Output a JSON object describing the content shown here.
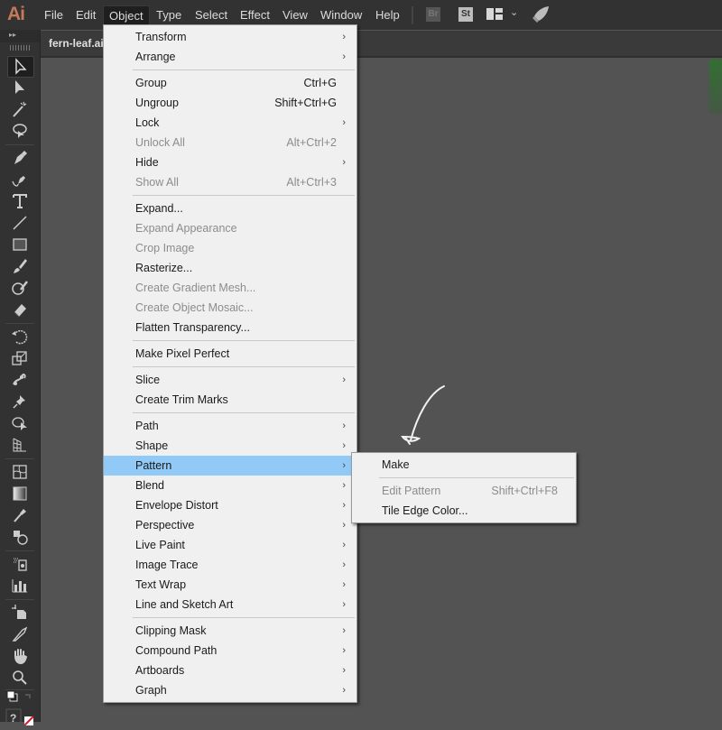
{
  "app": {
    "logo": "Ai",
    "document_tab": "fern-leaf.ai"
  },
  "menubar": {
    "items": [
      "File",
      "Edit",
      "Object",
      "Type",
      "Select",
      "Effect",
      "View",
      "Window",
      "Help"
    ],
    "active": "Object",
    "bridge_label": "Br",
    "stock_label": "St"
  },
  "object_menu": {
    "items": [
      {
        "label": "Transform",
        "submenu": true
      },
      {
        "label": "Arrange",
        "submenu": true
      },
      {
        "sep": true
      },
      {
        "label": "Group",
        "shortcut": "Ctrl+G"
      },
      {
        "label": "Ungroup",
        "shortcut": "Shift+Ctrl+G"
      },
      {
        "label": "Lock",
        "submenu": true
      },
      {
        "label": "Unlock All",
        "shortcut": "Alt+Ctrl+2",
        "disabled": true
      },
      {
        "label": "Hide",
        "submenu": true
      },
      {
        "label": "Show All",
        "shortcut": "Alt+Ctrl+3",
        "disabled": true
      },
      {
        "sep": true
      },
      {
        "label": "Expand..."
      },
      {
        "label": "Expand Appearance",
        "disabled": true
      },
      {
        "label": "Crop Image",
        "disabled": true
      },
      {
        "label": "Rasterize..."
      },
      {
        "label": "Create Gradient Mesh...",
        "disabled": true
      },
      {
        "label": "Create Object Mosaic...",
        "disabled": true
      },
      {
        "label": "Flatten Transparency..."
      },
      {
        "sep": true
      },
      {
        "label": "Make Pixel Perfect"
      },
      {
        "sep": true
      },
      {
        "label": "Slice",
        "submenu": true
      },
      {
        "label": "Create Trim Marks"
      },
      {
        "sep": true
      },
      {
        "label": "Path",
        "submenu": true
      },
      {
        "label": "Shape",
        "submenu": true
      },
      {
        "label": "Pattern",
        "submenu": true,
        "highlighted": true
      },
      {
        "label": "Blend",
        "submenu": true
      },
      {
        "label": "Envelope Distort",
        "submenu": true
      },
      {
        "label": "Perspective",
        "submenu": true
      },
      {
        "label": "Live Paint",
        "submenu": true
      },
      {
        "label": "Image Trace",
        "submenu": true
      },
      {
        "label": "Text Wrap",
        "submenu": true
      },
      {
        "label": "Line and Sketch Art",
        "submenu": true
      },
      {
        "sep": true
      },
      {
        "label": "Clipping Mask",
        "submenu": true
      },
      {
        "label": "Compound Path",
        "submenu": true
      },
      {
        "label": "Artboards",
        "submenu": true
      },
      {
        "label": "Graph",
        "submenu": true
      }
    ]
  },
  "pattern_submenu": {
    "items": [
      {
        "label": "Make"
      },
      {
        "sep": true
      },
      {
        "label": "Edit Pattern",
        "shortcut": "Shift+Ctrl+F8",
        "disabled": true
      },
      {
        "label": "Tile Edge Color..."
      }
    ]
  },
  "toolbar": {
    "tools": [
      "selection-tool",
      "direct-selection-tool",
      "magic-wand-tool",
      "lasso-tool",
      "pen-tool",
      "curvature-tool",
      "type-tool",
      "line-segment-tool",
      "rectangle-tool",
      "paintbrush-tool",
      "shaper-tool",
      "eraser-tool",
      "rotate-tool",
      "scale-tool",
      "puppet-warp-tool",
      "pin-tool",
      "shape-builder-tool",
      "perspective-grid-tool",
      "mesh-tool",
      "gradient-tool",
      "eyedropper-tool",
      "blend-tool",
      "symbol-sprayer-tool",
      "column-graph-tool",
      "artboard-tool",
      "slice-tool",
      "hand-tool",
      "zoom-tool"
    ],
    "selected": "selection-tool"
  },
  "colors": {
    "highlight": "#91c9f7",
    "menu_bg": "#f0f0f0",
    "ui_dark": "#323232",
    "canvas": "#535353",
    "logo": "#c3795a"
  }
}
